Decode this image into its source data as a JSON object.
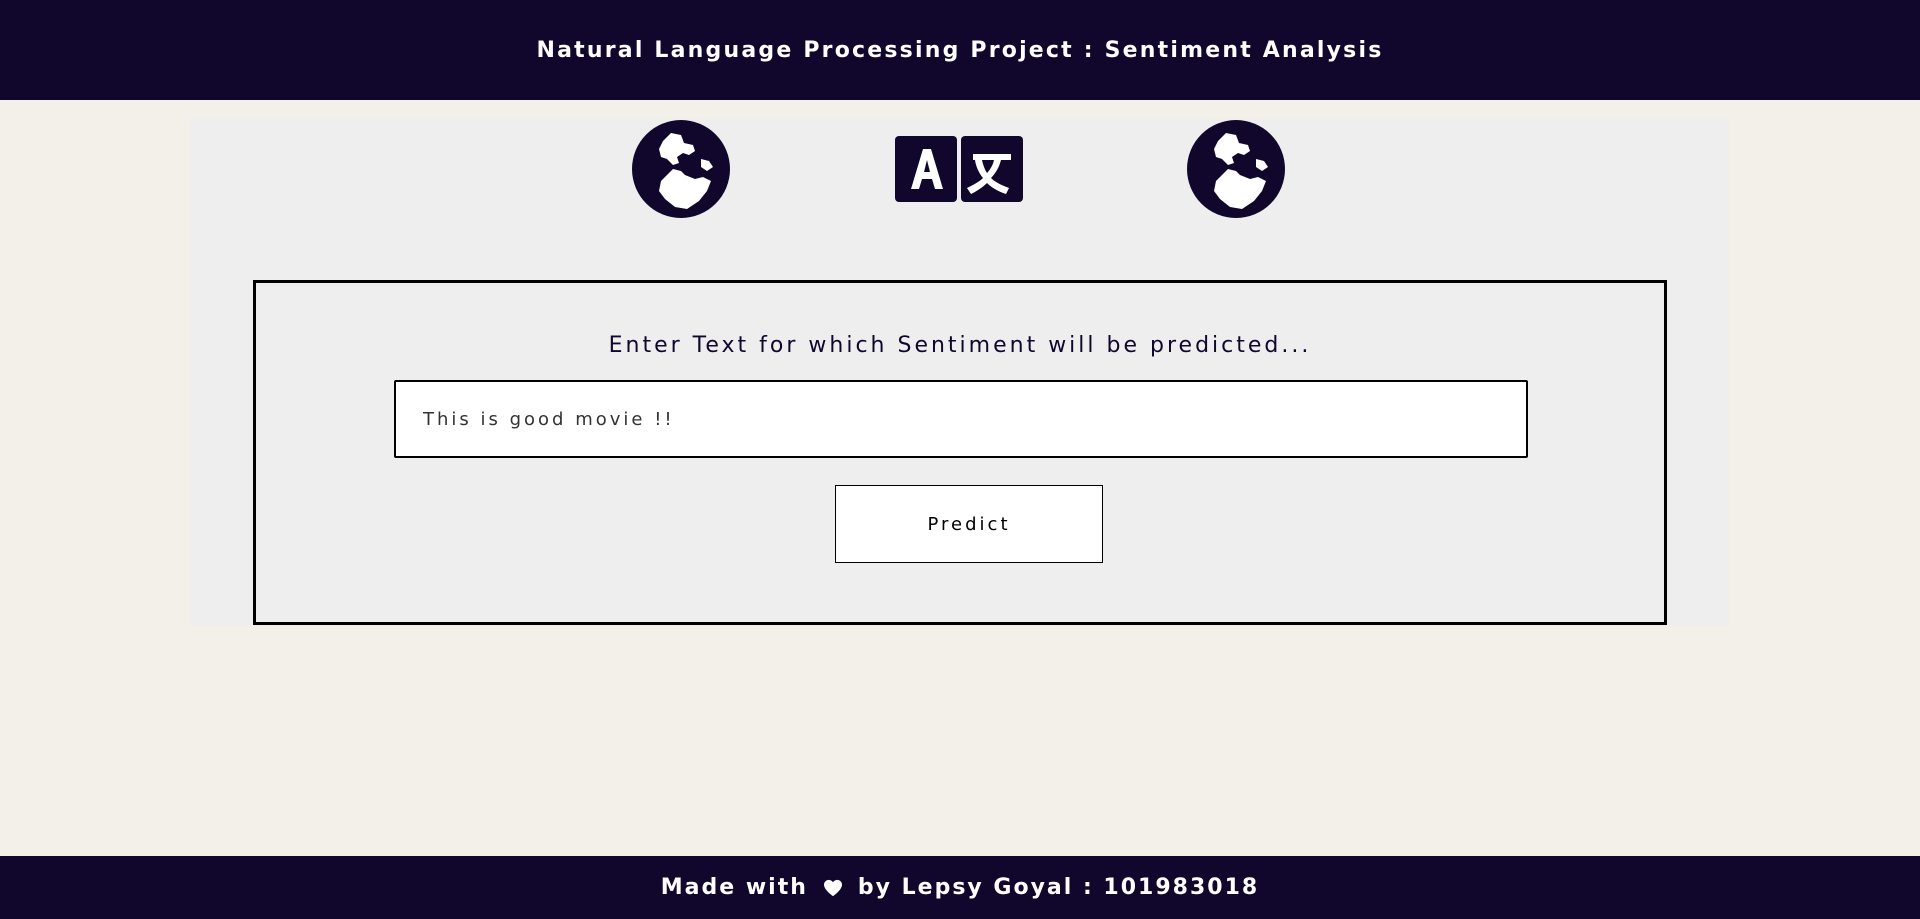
{
  "header": {
    "title": "Natural Language Processing Project : Sentiment Analysis"
  },
  "icons": [
    "globe-icon",
    "translate-icon",
    "globe-icon"
  ],
  "form": {
    "prompt": "Enter Text for which Sentiment will be predicted...",
    "input_value": "This is good movie !!",
    "predict_label": "Predict"
  },
  "footer": {
    "made_with": "Made with",
    "by_text": "by Lepsy Goyal : 101983018"
  },
  "colors": {
    "brand_dark": "#11072c",
    "page_bg": "#f3efe9",
    "panel_bg": "#eeeeee"
  }
}
